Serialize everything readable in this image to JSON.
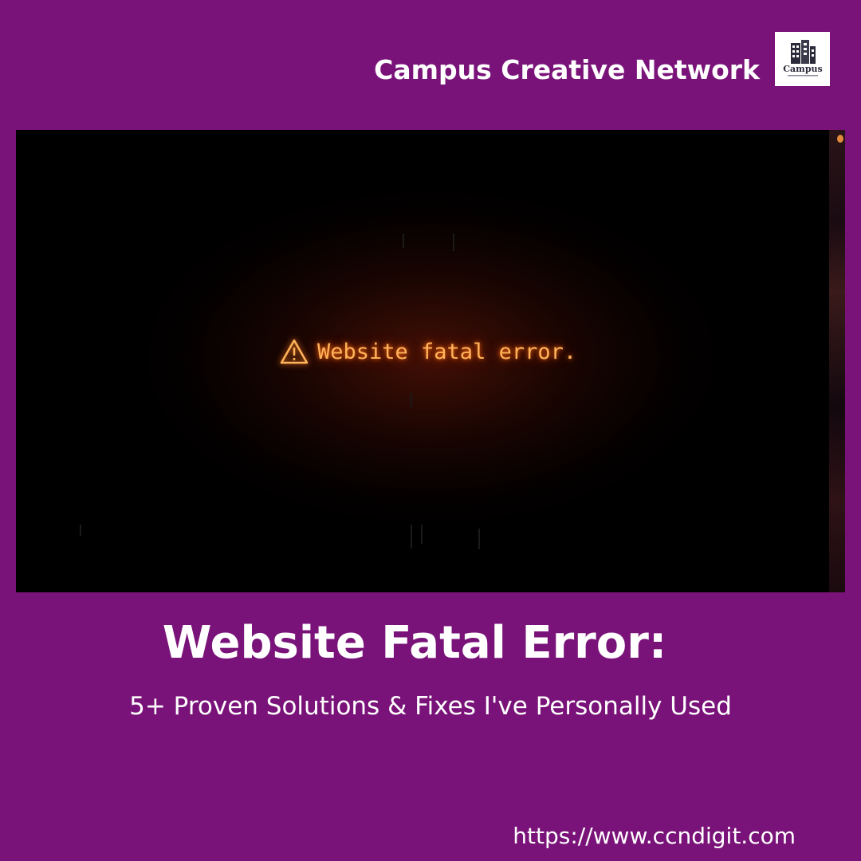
{
  "brand": {
    "name": "Campus Creative Network",
    "logo_text": "Campus",
    "logo_icon": "building-logo-icon"
  },
  "hero": {
    "error_icon": "warning-triangle-icon",
    "error_text": "Website fatal error."
  },
  "headline": {
    "title": "Website Fatal Error:",
    "subtitle": "5+ Proven Solutions & Fixes I've Personally Used"
  },
  "footer": {
    "url": "https://www.ccndigit.com"
  },
  "colors": {
    "background": "#7a1379",
    "text": "#ffffff",
    "error_glow": "#ffb35a"
  }
}
